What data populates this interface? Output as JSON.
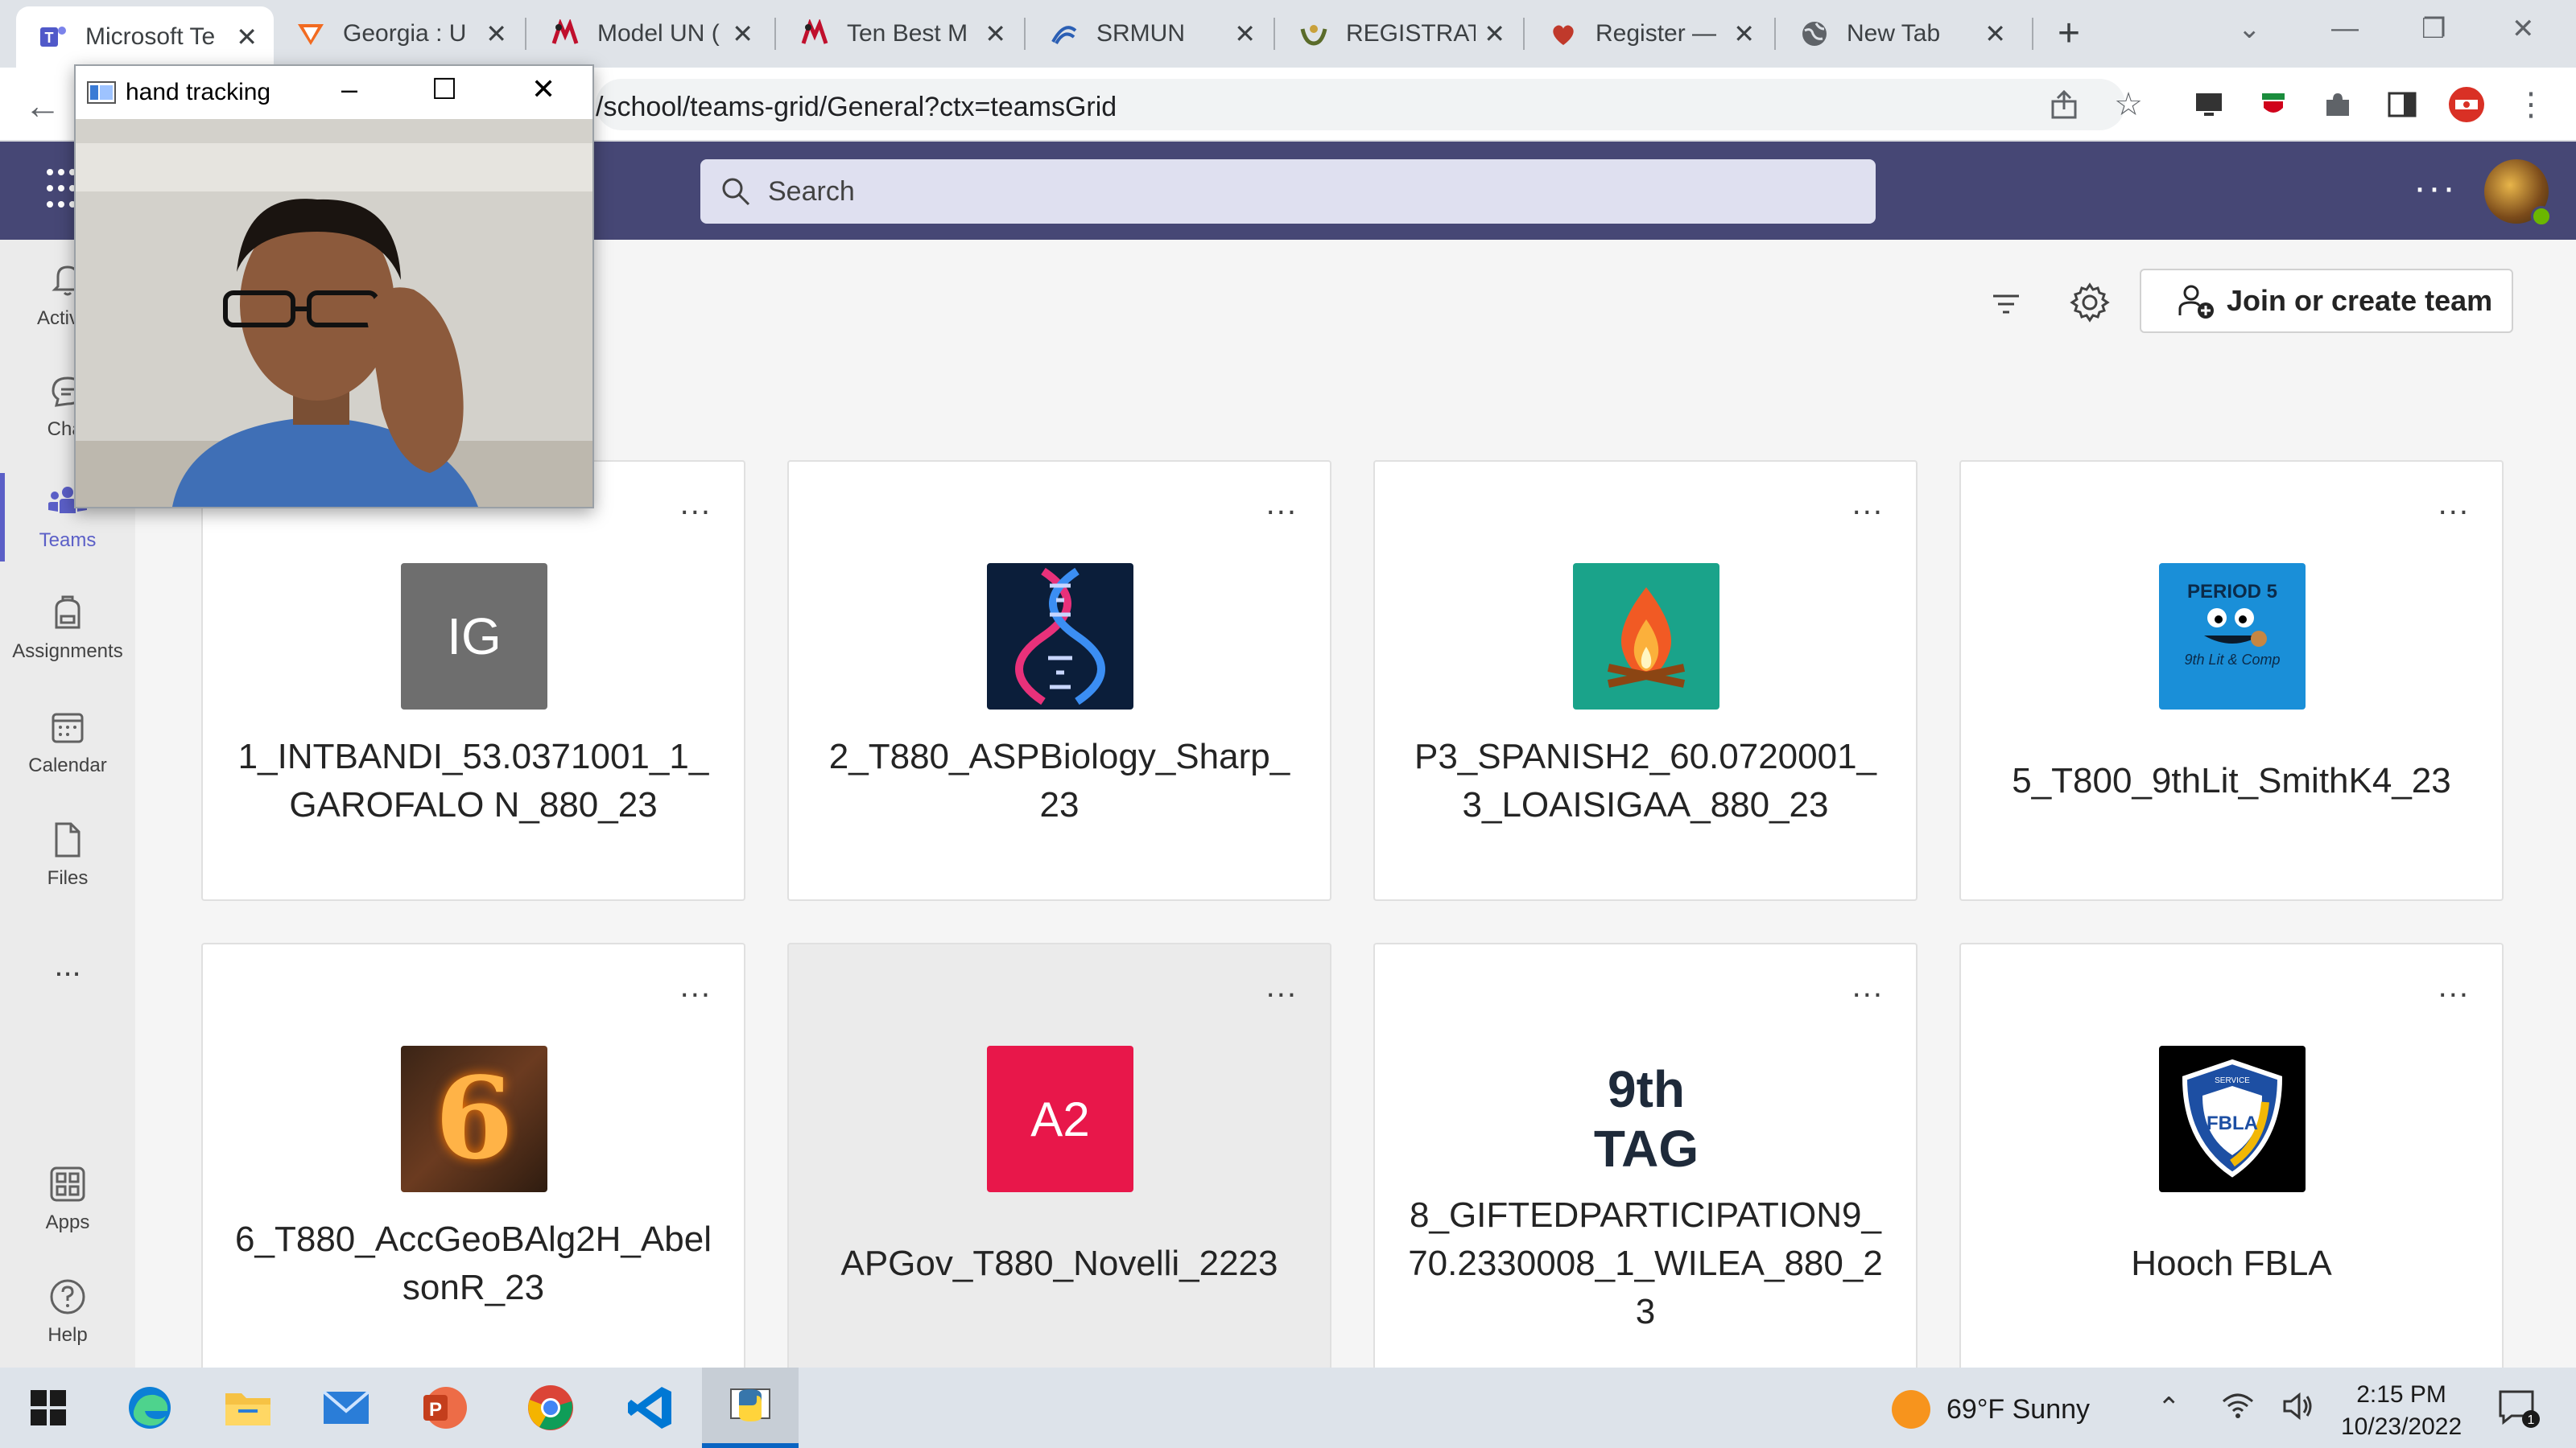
{
  "browser": {
    "tabs": [
      {
        "label": "Microsoft Te",
        "icon": "teams-icon",
        "active": true
      },
      {
        "label": "Georgia : U",
        "icon": "georgia-favicon"
      },
      {
        "label": "Model UN (",
        "icon": "model-un-favicon"
      },
      {
        "label": "Ten Best M",
        "icon": "ten-best-favicon"
      },
      {
        "label": "SRMUN",
        "icon": "srmun-favicon"
      },
      {
        "label": "REGISTRAT",
        "icon": "registration-favicon"
      },
      {
        "label": "Register —",
        "icon": "register-favicon"
      },
      {
        "label": "New Tab",
        "icon": "globe-icon"
      }
    ],
    "url": "/school/teams-grid/General?ctx=teamsGrid"
  },
  "teams": {
    "search_placeholder": "Search",
    "rail": [
      {
        "label": "Activity",
        "icon": "bell-icon"
      },
      {
        "label": "Chat",
        "icon": "chat-icon"
      },
      {
        "label": "Teams",
        "icon": "teams-icon",
        "active": true
      },
      {
        "label": "Assignments",
        "icon": "backpack-icon"
      },
      {
        "label": "Calendar",
        "icon": "calendar-icon"
      },
      {
        "label": "Files",
        "icon": "file-icon"
      },
      {
        "label": "...",
        "icon": "more-icon"
      },
      {
        "label": "Apps",
        "icon": "apps-icon"
      },
      {
        "label": "Help",
        "icon": "help-icon"
      }
    ],
    "join_button": "Join or create team",
    "cards": [
      {
        "name": "1_INTBANDI_53.0371001_1_GAROFALO N_880_23",
        "logo_text": "IG"
      },
      {
        "name": "2_T880_ASPBiology_Sharp_23",
        "logo": "dna"
      },
      {
        "name": "P3_SPANISH2_60.0720001_3_LOAISIGAA_880_23",
        "logo": "campfire"
      },
      {
        "name": "5_T800_9thLit_SmithK4_23",
        "logo_text": "PERIOD 5",
        "logo_subtext": "9th Lit & Comp"
      },
      {
        "name": "6_T880_AccGeoBAlg2H_AbelsonR_23",
        "logo_text": "6"
      },
      {
        "name": "APGov_T880_Novelli_2223",
        "logo_text": "A2"
      },
      {
        "name": "8_GIFTEDPARTICIPATION9_70.2330008_1_WILEA_880_23",
        "logo_text": "9th",
        "logo_subtext": "TAG"
      },
      {
        "name": "Hooch FBLA",
        "logo_text": "FBLA",
        "logo_subtext": "SERVICE"
      }
    ],
    "card_more": "..."
  },
  "hand_tracking": {
    "title": "hand tracking"
  },
  "taskbar": {
    "weather": "69°F  Sunny",
    "time": "2:15 PM",
    "date": "10/23/2022",
    "notifications": "1"
  },
  "colors": {
    "teams_header": "#464775",
    "accent": "#5b5fc7",
    "ig_logo": "#6e6e6e",
    "dna_bg": "#0b1e3a",
    "campfire_bg": "#1aa38a",
    "period5_bg": "#1a8fd8",
    "a2_bg": "#e8174a"
  }
}
